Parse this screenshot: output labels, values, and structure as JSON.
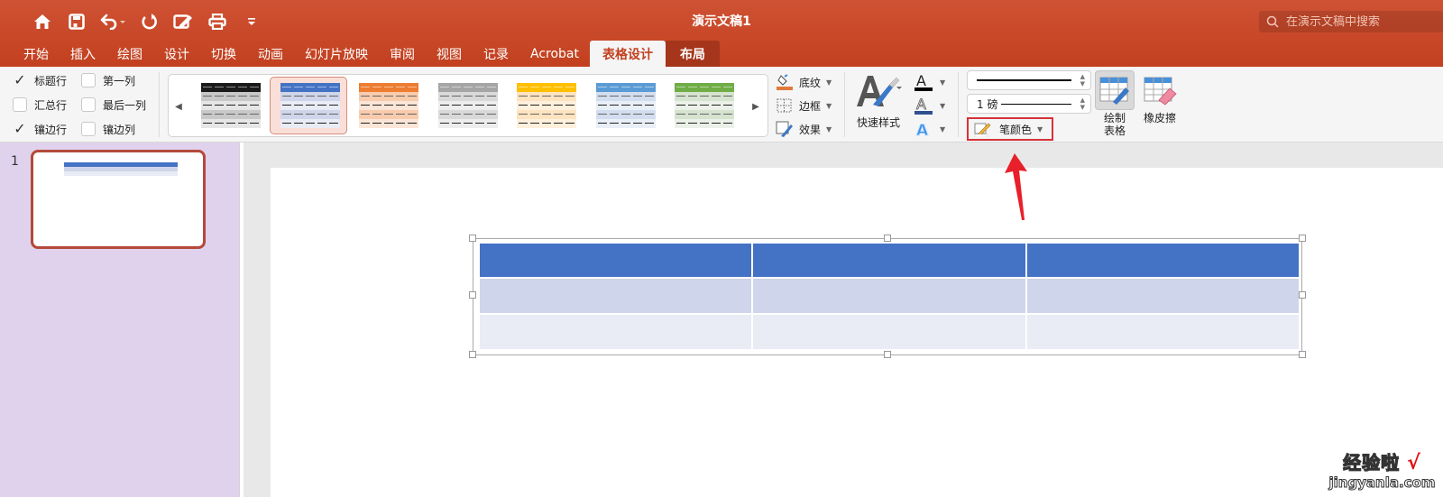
{
  "window": {
    "title": "演示文稿1",
    "search_placeholder": "在演示文稿中搜索"
  },
  "quick_access": [
    {
      "icon": "home-icon"
    },
    {
      "icon": "save-icon"
    },
    {
      "icon": "undo-icon"
    },
    {
      "icon": "redo-icon"
    },
    {
      "icon": "edit-document-icon"
    },
    {
      "icon": "print-icon"
    },
    {
      "icon": "customize-toolbar-icon"
    }
  ],
  "tabs": [
    {
      "label": "开始"
    },
    {
      "label": "插入"
    },
    {
      "label": "绘图"
    },
    {
      "label": "设计"
    },
    {
      "label": "切换"
    },
    {
      "label": "动画"
    },
    {
      "label": "幻灯片放映"
    },
    {
      "label": "审阅"
    },
    {
      "label": "视图"
    },
    {
      "label": "记录"
    },
    {
      "label": "Acrobat"
    },
    {
      "label": "表格设计",
      "active": true
    },
    {
      "label": "布局",
      "contextual": true
    }
  ],
  "ribbon": {
    "options": [
      {
        "label": "标题行",
        "checked": true
      },
      {
        "label": "第一列",
        "checked": false
      },
      {
        "label": "汇总行",
        "checked": false
      },
      {
        "label": "最后一列",
        "checked": false
      },
      {
        "label": "镶边行",
        "checked": true
      },
      {
        "label": "镶边列",
        "checked": false
      }
    ],
    "styles": [
      {
        "header": "#1a1a1a",
        "band1": "#c8c8c8",
        "band2": "#e6e6e6",
        "selected": false
      },
      {
        "header": "#4472c4",
        "band1": "#cfd5ea",
        "band2": "#e9ebf5",
        "selected": true
      },
      {
        "header": "#ed7d31",
        "band1": "#f8cbad",
        "band2": "#fbe5d6",
        "selected": false
      },
      {
        "header": "#a5a5a5",
        "band1": "#d9d9d9",
        "band2": "#ededed",
        "selected": false
      },
      {
        "header": "#ffc000",
        "band1": "#fde3c0",
        "band2": "#fff0dc",
        "selected": false
      },
      {
        "header": "#5b9bd5",
        "band1": "#d2deef",
        "band2": "#e9eff7",
        "selected": false
      },
      {
        "header": "#70ad47",
        "band1": "#d5e3cf",
        "band2": "#ebf1e9",
        "selected": false
      }
    ],
    "shading_label": "底纹",
    "borders_label": "边框",
    "effects_label": "效果",
    "quick_styles_label": "快速样式",
    "pen_weight_label": "1 磅",
    "pen_color_label": "笔颜色",
    "draw_table_label_1": "绘制",
    "draw_table_label_2": "表格",
    "eraser_label": "橡皮擦"
  },
  "thumbnails": [
    {
      "number": "1",
      "selected": true
    }
  ],
  "table": {
    "rows": 3,
    "cols": 3,
    "style_colors": {
      "header": "#4472c4",
      "band1": "#cfd5ea",
      "band2": "#e9ebf5"
    }
  },
  "watermark": {
    "line1": "经验啦",
    "tick": "√",
    "line2": "jingyanla.com"
  }
}
